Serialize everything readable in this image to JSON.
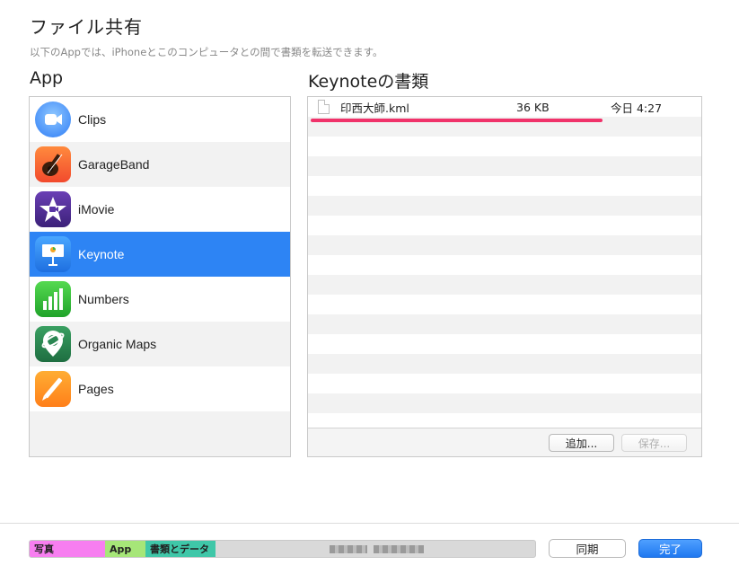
{
  "header": {
    "title": "ファイル共有",
    "subtitle": "以下のAppでは、iPhoneとこのコンピュータとの間で書類を転送できます。"
  },
  "apps_panel": {
    "heading": "App",
    "items": [
      {
        "label": "Clips",
        "icon": "clips-icon"
      },
      {
        "label": "GarageBand",
        "icon": "garageband-icon"
      },
      {
        "label": "iMovie",
        "icon": "imovie-icon"
      },
      {
        "label": "Keynote",
        "icon": "keynote-icon",
        "selected": true
      },
      {
        "label": "Numbers",
        "icon": "numbers-icon"
      },
      {
        "label": "Organic Maps",
        "icon": "organic-maps-icon"
      },
      {
        "label": "Pages",
        "icon": "pages-icon"
      }
    ]
  },
  "documents_panel": {
    "heading": "Keynoteの書類",
    "files": [
      {
        "name": "印西大師.kml",
        "size": "36 KB",
        "modified": "今日 4:27"
      }
    ],
    "add_label": "追加...",
    "save_label": "保存..."
  },
  "footer": {
    "storage": {
      "photos_label": "写真",
      "apps_label": "App",
      "docs_label": "書類とデータ"
    },
    "sync_label": "同期",
    "done_label": "完了"
  },
  "colors": {
    "selection": "#2d84f4",
    "highlight_underline": "#f0326a",
    "photos_segment": "#f77ef0",
    "apps_segment": "#a6e678",
    "docs_segment": "#3fc7a8",
    "done_button": "#1f78f0"
  }
}
